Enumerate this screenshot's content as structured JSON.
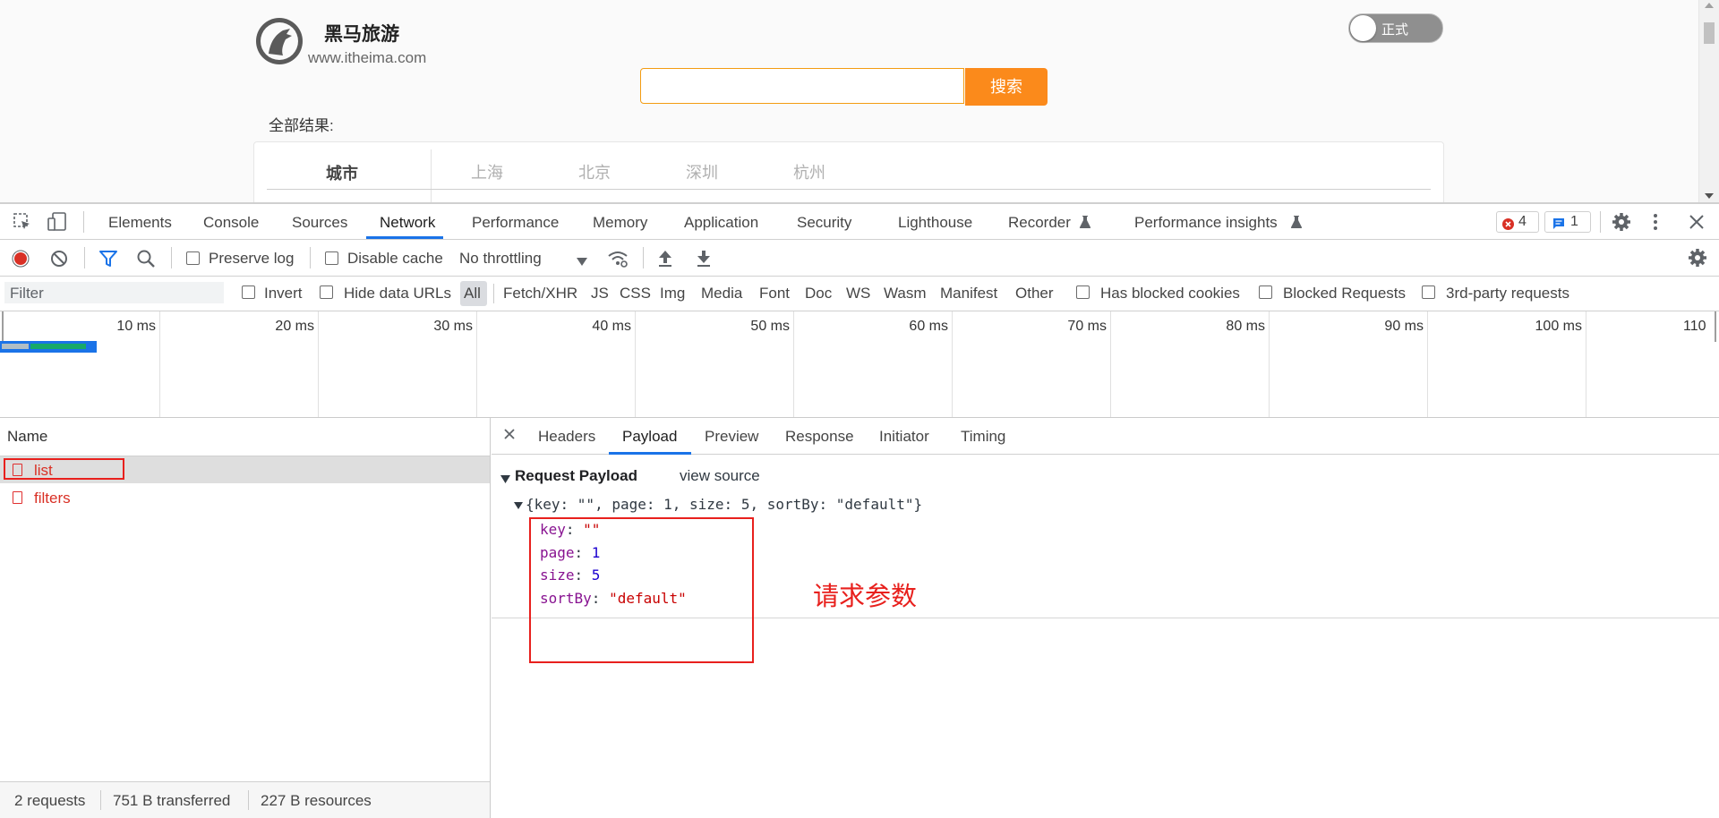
{
  "site": {
    "brand_name": "黑马旅游",
    "brand_url": "www.itheima.com",
    "toggle_label": "正式",
    "search_button": "搜索",
    "search_value": "",
    "all_results_label": "全部结果:",
    "filter_label": "城市",
    "cities": [
      "上海",
      "北京",
      "深圳",
      "杭州"
    ]
  },
  "devtools": {
    "tabs": [
      "Elements",
      "Console",
      "Sources",
      "Network",
      "Performance",
      "Memory",
      "Application",
      "Security",
      "Lighthouse",
      "Recorder",
      "Performance insights"
    ],
    "active_tab": "Network",
    "error_count": "4",
    "message_count": "1",
    "toolbar": {
      "preserve_log": "Preserve log",
      "disable_cache": "Disable cache",
      "throttling": "No throttling"
    },
    "filter": {
      "placeholder": "Filter",
      "invert": "Invert",
      "hide_data_urls": "Hide data URLs",
      "types": [
        "All",
        "Fetch/XHR",
        "JS",
        "CSS",
        "Img",
        "Media",
        "Font",
        "Doc",
        "WS",
        "Wasm",
        "Manifest",
        "Other"
      ],
      "has_blocked_cookies": "Has blocked cookies",
      "blocked_requests": "Blocked Requests",
      "third_party": "3rd-party requests"
    },
    "timeline_labels": [
      "10 ms",
      "20 ms",
      "30 ms",
      "40 ms",
      "50 ms",
      "60 ms",
      "70 ms",
      "80 ms",
      "90 ms",
      "100 ms",
      "110"
    ],
    "name_header": "Name",
    "requests": [
      {
        "name": "list"
      },
      {
        "name": "filters"
      }
    ],
    "status": {
      "requests": "2 requests",
      "transferred": "751 B transferred",
      "resources": "227 B resources"
    },
    "detail_tabs": [
      "Headers",
      "Payload",
      "Preview",
      "Response",
      "Initiator",
      "Timing"
    ],
    "active_detail_tab": "Payload",
    "payload": {
      "section_title": "Request Payload",
      "view_source": "view source",
      "summary": "{key: \"\", page: 1, size: 5, sortBy: \"default\"}",
      "fields": [
        {
          "key": "key",
          "value": "\"\"",
          "type": "string"
        },
        {
          "key": "page",
          "value": "1",
          "type": "number"
        },
        {
          "key": "size",
          "value": "5",
          "type": "number"
        },
        {
          "key": "sortBy",
          "value": "\"default\"",
          "type": "string"
        }
      ]
    }
  },
  "annotation_text": "请求参数",
  "colors": {
    "accent_blue": "#1a73e8",
    "search_orange": "#fb8a1b",
    "annotation_red": "#e8201d",
    "request_red": "#d93025"
  }
}
